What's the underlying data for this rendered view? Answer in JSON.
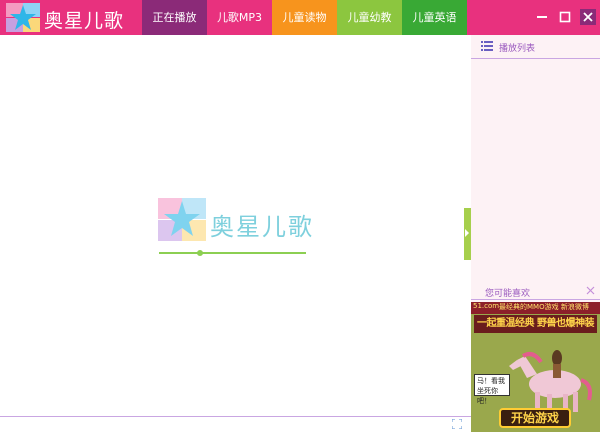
{
  "app": {
    "title": "奥星儿歌",
    "brand_color": "#e8317e"
  },
  "nav": {
    "tabs": [
      {
        "label": "正在播放",
        "color": "#8b2a78",
        "active": true
      },
      {
        "label": "儿歌MP3",
        "color": "#e8317e",
        "active": false
      },
      {
        "label": "儿童读物",
        "color": "#f7941d",
        "active": false
      },
      {
        "label": "儿童幼教",
        "color": "#8cc63f",
        "active": false
      },
      {
        "label": "儿童英语",
        "color": "#39a935",
        "active": false
      }
    ]
  },
  "window_controls": {
    "icons": [
      "minimize-icon",
      "maximize-icon",
      "close-icon"
    ]
  },
  "player": {
    "center_title": "奥星儿歌",
    "progress": 0.27,
    "accent_color": "#8ccf52"
  },
  "sidepanel": {
    "playlist_label": "播放列表",
    "like_label": "您可能喜欢"
  },
  "ad": {
    "source": "51.com",
    "top_text": "最经典的MMO游戏 新浪微博",
    "headline": "一起重温经典 野兽也爆神装",
    "bubble": "马！看我坐死你吧！",
    "button_label": "开始游戏"
  }
}
